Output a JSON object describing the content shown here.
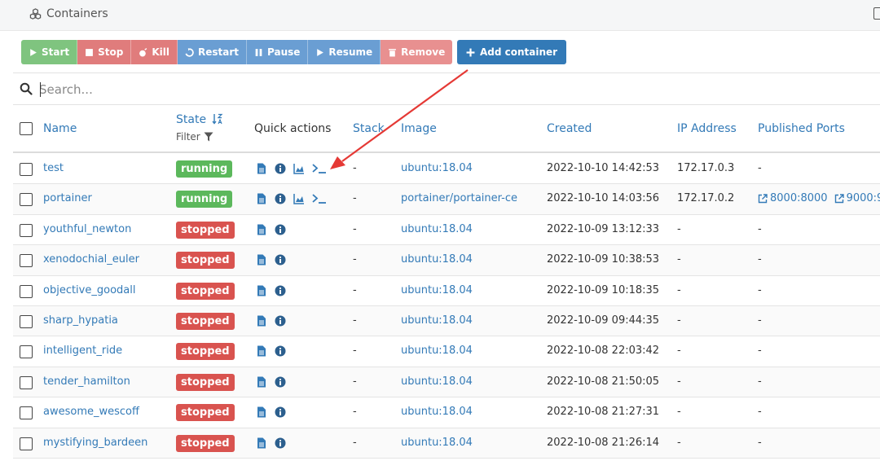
{
  "window": {
    "title": "Containers"
  },
  "toolbar": {
    "start": "Start",
    "stop": "Stop",
    "kill": "Kill",
    "restart": "Restart",
    "pause": "Pause",
    "resume": "Resume",
    "remove": "Remove",
    "add_container": "Add container"
  },
  "search": {
    "placeholder": "Search..."
  },
  "table": {
    "headers": {
      "name": "Name",
      "state": "State",
      "filter": "Filter",
      "quick_actions": "Quick actions",
      "stack": "Stack",
      "image": "Image",
      "created": "Created",
      "ip": "IP Address",
      "ports": "Published Ports"
    },
    "rows": [
      {
        "name": "test",
        "state": "running",
        "stack": "-",
        "image": "ubuntu:18.04",
        "created": "2022-10-10 14:42:53",
        "ip": "172.17.0.3",
        "ports": "-"
      },
      {
        "name": "portainer",
        "state": "running",
        "stack": "-",
        "image": "portainer/portainer-ce",
        "created": "2022-10-10 14:03:56",
        "ip": "172.17.0.2",
        "port1": "8000:8000",
        "port2": "9000:9"
      },
      {
        "name": "youthful_newton",
        "state": "stopped",
        "stack": "-",
        "image": "ubuntu:18.04",
        "created": "2022-10-09 13:12:33",
        "ip": "-",
        "ports": "-"
      },
      {
        "name": "xenodochial_euler",
        "state": "stopped",
        "stack": "-",
        "image": "ubuntu:18.04",
        "created": "2022-10-09 10:38:53",
        "ip": "-",
        "ports": "-"
      },
      {
        "name": "objective_goodall",
        "state": "stopped",
        "stack": "-",
        "image": "ubuntu:18.04",
        "created": "2022-10-09 10:18:35",
        "ip": "-",
        "ports": "-"
      },
      {
        "name": "sharp_hypatia",
        "state": "stopped",
        "stack": "-",
        "image": "ubuntu:18.04",
        "created": "2022-10-09 09:44:35",
        "ip": "-",
        "ports": "-"
      },
      {
        "name": "intelligent_ride",
        "state": "stopped",
        "stack": "-",
        "image": "ubuntu:18.04",
        "created": "2022-10-08 22:03:42",
        "ip": "-",
        "ports": "-"
      },
      {
        "name": "tender_hamilton",
        "state": "stopped",
        "stack": "-",
        "image": "ubuntu:18.04",
        "created": "2022-10-08 21:50:05",
        "ip": "-",
        "ports": "-"
      },
      {
        "name": "awesome_wescoff",
        "state": "stopped",
        "stack": "-",
        "image": "ubuntu:18.04",
        "created": "2022-10-08 21:27:31",
        "ip": "-",
        "ports": "-"
      },
      {
        "name": "mystifying_bardeen",
        "state": "stopped",
        "stack": "-",
        "image": "ubuntu:18.04",
        "created": "2022-10-08 21:26:14",
        "ip": "-",
        "ports": "-"
      }
    ]
  },
  "colors": {
    "accent": "#337ab7",
    "running": "#5cb85c",
    "stopped": "#d9534f",
    "annotation_arrow": "#e53935"
  },
  "icons": {
    "title": "cubes-icon",
    "search": "search-icon",
    "filter": "filter-icon",
    "quick_actions": [
      "logs-icon",
      "inspect-icon",
      "stats-icon",
      "console-icon"
    ],
    "port_link": "external-link-icon"
  }
}
